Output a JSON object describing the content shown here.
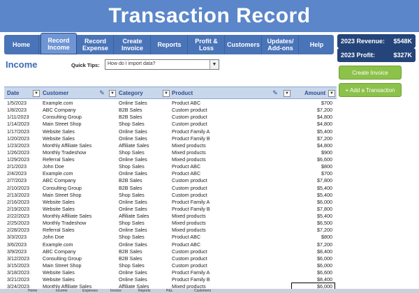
{
  "app": {
    "title": "Transaction Record"
  },
  "nav": [
    {
      "label": "Home",
      "active": false
    },
    {
      "label": "Record Income",
      "active": true
    },
    {
      "label": "Record Expense",
      "active": false
    },
    {
      "label": "Create Invoice",
      "active": false
    },
    {
      "label": "Reports",
      "active": false
    },
    {
      "label": "Profit & Loss",
      "active": false
    },
    {
      "label": "Customers",
      "active": false
    },
    {
      "label": "Updates/ Add-ons",
      "active": false
    },
    {
      "label": "Help",
      "active": false
    }
  ],
  "stats": {
    "revenue_label": "2023 Revenue:",
    "revenue_value": "$548K",
    "profit_label": "2023 Profit:",
    "profit_value": "$327K"
  },
  "page_title": "Income",
  "quick_tips": {
    "label": "Quick Tips:",
    "value": "How do I import data?"
  },
  "buttons": {
    "create_invoice": "Create Invoice",
    "add_transaction": "+ Add a Transaction"
  },
  "table": {
    "columns": [
      "Date",
      "Customer",
      "Category",
      "Product",
      "Amount"
    ],
    "rows": [
      [
        "1/5/2023",
        "Example.com",
        "Online Sales",
        "Product ABC",
        "$700"
      ],
      [
        "1/8/2023",
        "ABC Company",
        "B2B Sales",
        "Custom product",
        "$7,200"
      ],
      [
        "1/11/2023",
        "Consulting Group",
        "B2B Sales",
        "Custom product",
        "$4,800"
      ],
      [
        "1/14/2023",
        "Main Street Shop",
        "Shop Sales",
        "Custom product",
        "$4,800"
      ],
      [
        "1/17/2023",
        "Website Sales",
        "Online Sales",
        "Product Family A",
        "$5,400"
      ],
      [
        "1/20/2023",
        "Website Sales",
        "Online Sales",
        "Product Family B",
        "$7,200"
      ],
      [
        "1/23/2023",
        "Monthly Affiliate Sales",
        "Affiliate Sales",
        "Mixed products",
        "$4,800"
      ],
      [
        "1/26/2023",
        "Monthly Tradeshow",
        "Shop Sales",
        "Mixed products",
        "$900"
      ],
      [
        "1/29/2023",
        "Referral Sales",
        "Online Sales",
        "Mixed products",
        "$6,600"
      ],
      [
        "2/1/2023",
        "John Doe",
        "Shop Sales",
        "Product ABC",
        "$800"
      ],
      [
        "2/4/2023",
        "Example.com",
        "Online Sales",
        "Product ABC",
        "$700"
      ],
      [
        "2/7/2023",
        "ABC Company",
        "B2B Sales",
        "Custom product",
        "$7,800"
      ],
      [
        "2/10/2023",
        "Consulting Group",
        "B2B Sales",
        "Custom product",
        "$5,400"
      ],
      [
        "2/13/2023",
        "Main Street Shop",
        "Shop Sales",
        "Custom product",
        "$5,400"
      ],
      [
        "2/16/2023",
        "Website Sales",
        "Online Sales",
        "Product Family A",
        "$6,000"
      ],
      [
        "2/19/2023",
        "Website Sales",
        "Online Sales",
        "Product Family B",
        "$7,800"
      ],
      [
        "2/22/2023",
        "Monthly Affiliate Sales",
        "Affiliate Sales",
        "Mixed products",
        "$5,400"
      ],
      [
        "2/25/2023",
        "Monthly Tradeshow",
        "Shop Sales",
        "Mixed products",
        "$6,500"
      ],
      [
        "2/28/2023",
        "Referral Sales",
        "Online Sales",
        "Mixed products",
        "$7,200"
      ],
      [
        "3/3/2023",
        "John Doe",
        "Shop Sales",
        "Product ABC",
        "$800"
      ],
      [
        "3/6/2023",
        "Example.com",
        "Online Sales",
        "Product ABC",
        "$7,200"
      ],
      [
        "3/9/2023",
        "ABC Company",
        "B2B Sales",
        "Custom product",
        "$8,400"
      ],
      [
        "3/12/2023",
        "Consulting Group",
        "B2B Sales",
        "Custom product",
        "$6,000"
      ],
      [
        "3/15/2023",
        "Main Street Shop",
        "Shop Sales",
        "Custom product",
        "$6,000"
      ],
      [
        "3/18/2023",
        "Website Sales",
        "Online Sales",
        "Product Family A",
        "$6,600"
      ],
      [
        "3/21/2023",
        "Website Sales",
        "Online Sales",
        "Product Family B",
        "$8,400"
      ],
      [
        "3/24/2023",
        "Monthly Affiliate Sales",
        "Affiliate Sales",
        "Mixed products",
        "$6,000"
      ]
    ]
  },
  "sheet_tabs": [
    "Home",
    "Income",
    "Expenses",
    "Invoice",
    "Reports",
    "P&L",
    "Customers"
  ],
  "colors": {
    "accent": "#5b86c9",
    "nav": "#4a74b8",
    "stat": "#24447a",
    "button": "#8cc14a",
    "header_row": "#c9d7ec"
  }
}
